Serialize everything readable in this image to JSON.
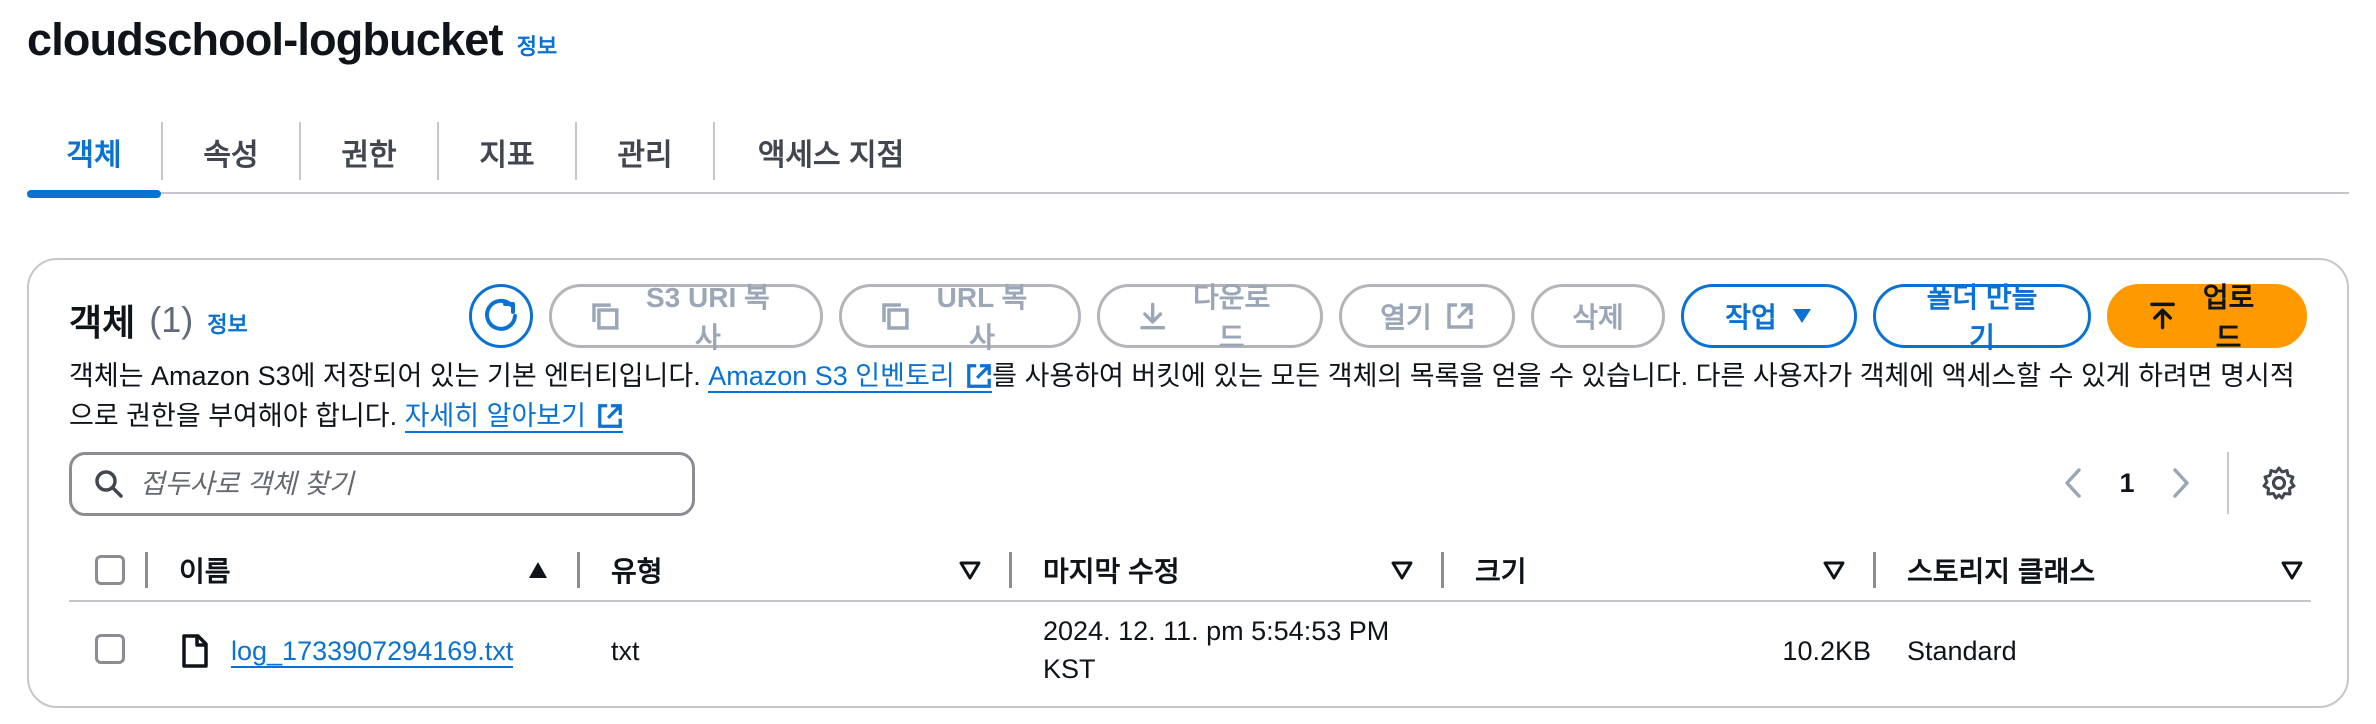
{
  "bucket": {
    "title": "cloudschool-logbucket",
    "info_label": "정보"
  },
  "tabs": [
    {
      "label": "객체",
      "active": true
    },
    {
      "label": "속성",
      "active": false
    },
    {
      "label": "권한",
      "active": false
    },
    {
      "label": "지표",
      "active": false
    },
    {
      "label": "관리",
      "active": false
    },
    {
      "label": "액세스 지점",
      "active": false
    }
  ],
  "objects": {
    "title": "객체",
    "count": "(1)",
    "info_label": "정보",
    "toolbar": {
      "copy_s3_uri": "S3 URI 복사",
      "copy_url": "URL 복사",
      "download": "다운로드",
      "open": "열기",
      "delete": "삭제",
      "actions": "작업",
      "create_folder": "폴더 만들기",
      "upload": "업로드"
    },
    "description": {
      "part1": "객체는 Amazon S3에 저장되어 있는 기본 엔터티입니다. ",
      "inventory_link": "Amazon S3 인벤토리 ",
      "part2": "를 사용하여 버킷에 있는 모든 객체의 목록을 얻을 수 있습니다. 다른 사용자가 객체에 액세스할 수 있게 하려면 명시적으로 권한을 부여해야 합니다. ",
      "learn_more_link": "자세히 알아보기 "
    },
    "search": {
      "placeholder": "접두사로 객체 찾기",
      "value": ""
    },
    "pagination": {
      "current_page": "1"
    },
    "columns": [
      "이름",
      "유형",
      "마지막 수정",
      "크기",
      "스토리지 클래스"
    ],
    "rows": [
      {
        "name": "log_1733907294169.txt",
        "type": "txt",
        "last_modified_line1": "2024. 12. 11. pm 5:54:53 PM",
        "last_modified_line2": "KST",
        "size": "10.2KB",
        "storage_class": "Standard"
      }
    ]
  },
  "colors": {
    "accent": "#0972d3",
    "upload": "#ff9900",
    "disabled": "#9ba7b6",
    "border": "#c6c6cd"
  }
}
